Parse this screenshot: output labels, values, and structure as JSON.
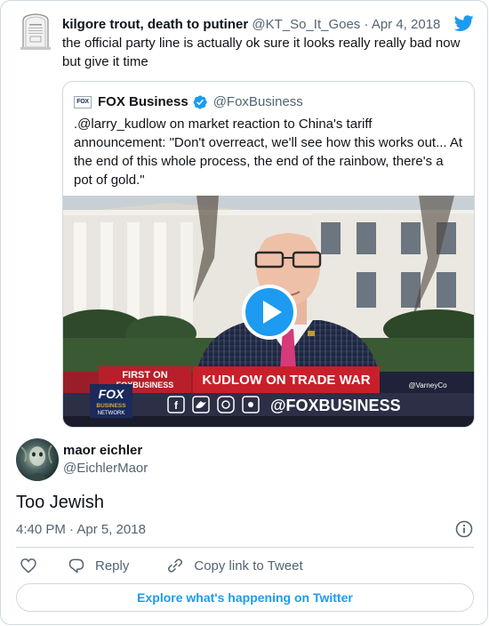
{
  "parent_tweet": {
    "author_name": "kilgore trout, death to putiner",
    "author_handle": "@KT_So_It_Goes",
    "separator": "·",
    "date": "Apr 4, 2018",
    "text": "the official party line is actually ok sure it looks really really bad now but give it time"
  },
  "quoted_tweet": {
    "badge_text": "FOX",
    "author_name": "FOX Business",
    "author_handle": "@FoxBusiness",
    "text": ".@larry_kudlow on market reaction to China's tariff announcement: \"Don't overreact, we'll see how this works out... At the end of this whole process, the end of the rainbow, there's a pot of gold.\"",
    "video": {
      "first_on_label": "FIRST ON",
      "first_on_brand": "FOXBUSINESS",
      "headline": "KUDLOW ON TRADE WAR",
      "corner_handle": "@VarneyCo",
      "social_handle": "@FOXBUSINESS",
      "network_logo_top": "FOX",
      "network_logo_mid": "BUSINESS",
      "network_logo_bottom": "NETWORK"
    }
  },
  "reply_tweet": {
    "author_name": "maor eichler",
    "author_handle": "@EichlerMaor",
    "text": "Too Jewish",
    "timestamp": "4:40 PM · Apr 5, 2018"
  },
  "actions": {
    "like_icon": "heart-icon",
    "reply_label": "Reply",
    "copy_link_label": "Copy link to Tweet"
  },
  "explore_label": "Explore what's happening on Twitter",
  "colors": {
    "accent": "#1d9bf0",
    "text_primary": "#0f1419",
    "text_secondary": "#536471",
    "border": "#cfd9de",
    "headline_red": "#c8202a"
  }
}
